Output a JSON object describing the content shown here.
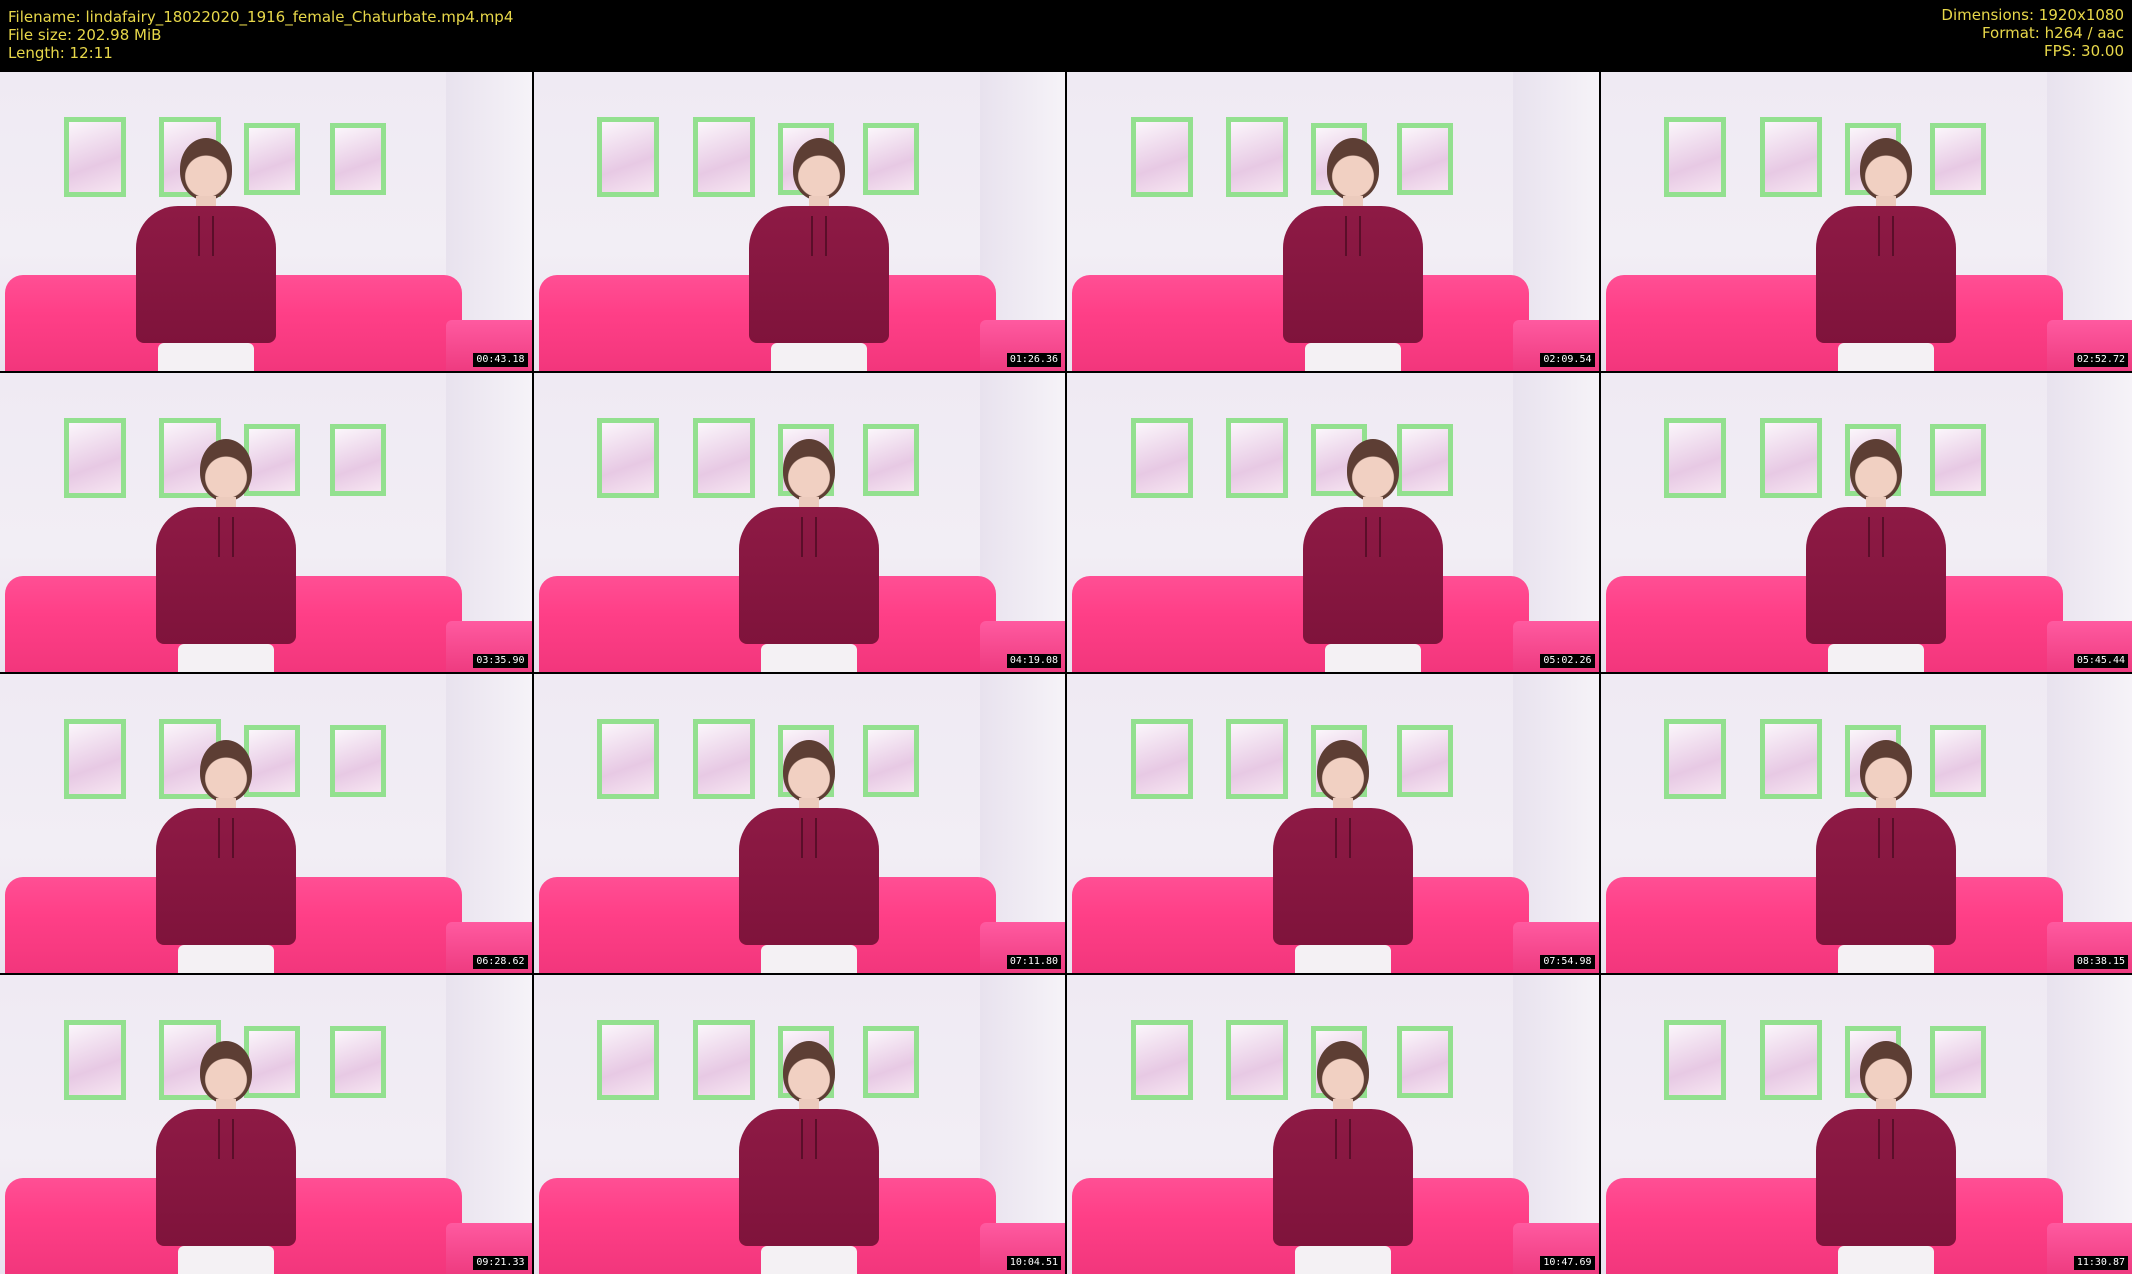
{
  "header": {
    "filename": "Filename: lindafairy_18022020_1916_female_Chaturbate.mp4.mp4",
    "filesize": "File size: 202.98 MiB",
    "length": "Length: 12:11",
    "dimensions": "Dimensions: 1920x1080",
    "format": "Format: h264 / aac",
    "fps": "FPS: 30.00"
  },
  "colors": {
    "header_text": "#e8d84a",
    "couch": "#ff3f87",
    "sweater": "#8e1a45",
    "frame_border": "#93e08f"
  },
  "thumbnails": [
    {
      "timestamp": "00:43.18"
    },
    {
      "timestamp": "01:26.36"
    },
    {
      "timestamp": "02:09.54"
    },
    {
      "timestamp": "02:52.72"
    },
    {
      "timestamp": "03:35.90"
    },
    {
      "timestamp": "04:19.08"
    },
    {
      "timestamp": "05:02.26"
    },
    {
      "timestamp": "05:45.44"
    },
    {
      "timestamp": "06:28.62"
    },
    {
      "timestamp": "07:11.80"
    },
    {
      "timestamp": "07:54.98"
    },
    {
      "timestamp": "08:38.15"
    },
    {
      "timestamp": "09:21.33"
    },
    {
      "timestamp": "10:04.51"
    },
    {
      "timestamp": "10:47.69"
    },
    {
      "timestamp": "11:30.87"
    }
  ]
}
